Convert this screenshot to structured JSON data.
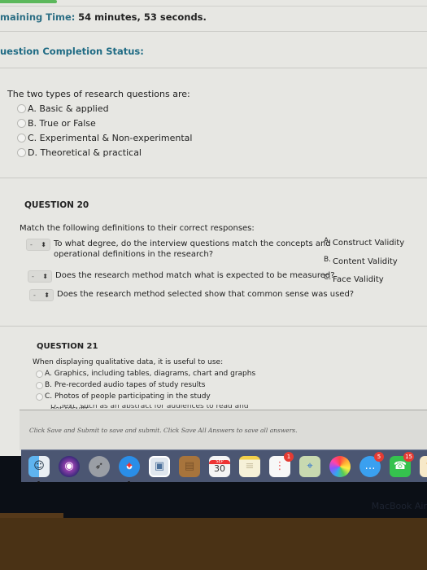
{
  "header": {
    "timer_label": "maining Time:",
    "timer_value": "54 minutes, 53 seconds.",
    "completion_label": "uestion Completion Status:"
  },
  "question19": {
    "prompt": "The two types of research questions are:",
    "options": [
      "A. Basic & applied",
      "B. True or False",
      "C. Experimental & Non-experimental",
      "D. Theoretical & practical"
    ]
  },
  "question20": {
    "header": "QUESTION 20",
    "prompt": "Match the following definitions to their correct responses:",
    "rows": [
      {
        "select_value": "-",
        "text_line1": "To what degree, do the interview questions match the concepts and",
        "text_line2": "operational definitions in the research?"
      },
      {
        "select_value": "-",
        "text_line1": "Does the research method match what is expected to be measured?"
      },
      {
        "select_value": "-",
        "text_line1": "Does the research method selected show that common sense was used?"
      }
    ],
    "answers": [
      {
        "letter": "A.",
        "text": "Construct Validity"
      },
      {
        "letter": "B.",
        "text": "Content Validity"
      },
      {
        "letter": "C.",
        "text": "Face Validity"
      }
    ]
  },
  "question21": {
    "header": "QUESTION 21",
    "prompt": "When displaying qualitative data, it is useful to use:",
    "options": [
      "A. Graphics, including tables, diagrams, chart and graphs",
      "B. Pre-recorded audio tapes of study results",
      "C. Photos of people participating in the study",
      "D. Text, such as an abstract for audiences to read and get results"
    ]
  },
  "footer": {
    "instructions": "Click Save and Submit to save and submit. Click Save All Answers to save all answers."
  },
  "dock": {
    "items": [
      {
        "name": "finder",
        "icon": "☺",
        "color": "#3c8fe0"
      },
      {
        "name": "siri",
        "icon": "◉",
        "color": "#7a3bb0"
      },
      {
        "name": "launchpad",
        "icon": "🚀",
        "color": "#8b8f96"
      },
      {
        "name": "safari",
        "icon": "✦",
        "color": "#1f7fe0"
      },
      {
        "name": "preview",
        "icon": "▣",
        "color": "#5f87b5"
      },
      {
        "name": "contacts",
        "icon": "▤",
        "color": "#9a6d3a"
      },
      {
        "name": "calendar",
        "icon": "30",
        "color": "#f2f2f2",
        "label": "SEP"
      },
      {
        "name": "notes",
        "icon": "≡",
        "color": "#f5e9a8"
      },
      {
        "name": "reminders",
        "icon": "⋮",
        "color": "#f7f7f7",
        "badge": "1"
      },
      {
        "name": "maps",
        "icon": "⌖",
        "color": "#bfd3a6"
      },
      {
        "name": "photos",
        "icon": "✿",
        "color": "#f1f1f1"
      },
      {
        "name": "messages",
        "icon": "…",
        "color": "#3aa0f0",
        "badge": "5"
      },
      {
        "name": "facetime",
        "icon": "☎",
        "color": "#35c24e",
        "badge": "15"
      },
      {
        "name": "pages",
        "icon": "✎",
        "color": "#f0a030"
      }
    ],
    "calendar_day": "30",
    "calendar_month": "SEP"
  },
  "bezel": {
    "label": "MacBook Air"
  }
}
